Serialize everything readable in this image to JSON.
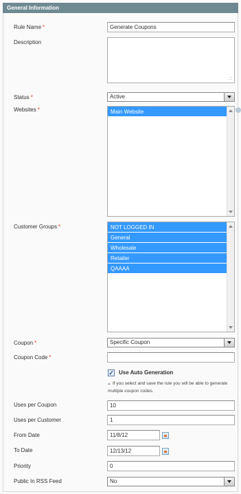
{
  "header": {
    "title": "General Information"
  },
  "fields": {
    "rule_name": {
      "label": "Rule Name",
      "value": "Generate Coupons"
    },
    "description": {
      "label": "Description",
      "value": ""
    },
    "status": {
      "label": "Status",
      "value": "Active"
    },
    "websites": {
      "label": "Websites",
      "options": [
        "Main Website"
      ]
    },
    "customer_groups": {
      "label": "Customer Groups",
      "options": [
        "NOT LOGGED IN",
        "General",
        "Wholesale",
        "Retailer",
        "QAAAA"
      ]
    },
    "coupon": {
      "label": "Coupon",
      "value": "Specific Coupon"
    },
    "coupon_code": {
      "label": "Coupon Code",
      "value": ""
    },
    "auto_generation": {
      "label": "Use Auto Generation",
      "checked": true,
      "note": "If you select and save the rule you will be able to generate multiple coupon codes."
    },
    "uses_per_coupon": {
      "label": "Uses per Coupon",
      "value": "10"
    },
    "uses_per_customer": {
      "label": "Uses per Customer",
      "value": "1"
    },
    "from_date": {
      "label": "From Date",
      "value": "11/8/12"
    },
    "to_date": {
      "label": "To Date",
      "value": "12/13/12"
    },
    "priority": {
      "label": "Priority",
      "value": "0"
    },
    "rss_feed": {
      "label": "Public In RSS Feed",
      "value": "No"
    }
  },
  "required_mark": "*",
  "colors": {
    "header": "#6f8992",
    "selected": "#3399ff",
    "required": "#eb340a"
  },
  "icons": [
    "dropdown-arrow-icon",
    "calendar-icon",
    "help-icon",
    "resize-grip-icon",
    "checkmark-icon",
    "note-triangle-icon"
  ]
}
